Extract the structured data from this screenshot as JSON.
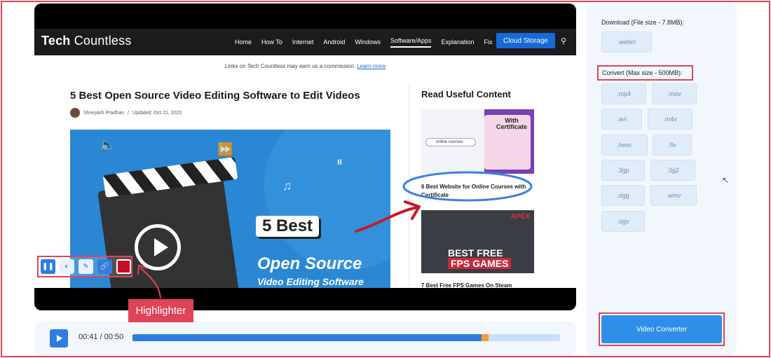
{
  "site": {
    "logo_bold": "Tech",
    "logo_rest": "Countless",
    "nav": [
      "Home",
      "How To",
      "Internet",
      "Android",
      "Windows",
      "Software/Apps",
      "Explanation",
      "Fix"
    ],
    "nav_active": "Software/Apps",
    "cloud_button": "Cloud Storage",
    "search_icon": "search-icon"
  },
  "affiliate": {
    "text": "Links on Tech Countless may earn us a commission.",
    "link": "Learn more"
  },
  "article": {
    "title": "5 Best Open Source Video Editing Software to Edit Videos",
    "author": "Shreyash Pradhan",
    "separator": "/",
    "updated": "Updated: Oct 21, 2022",
    "hero": {
      "badge": "5 Best",
      "line1": "Open Source",
      "line2": "Video Editing Software"
    }
  },
  "sidebar": {
    "title": "Read Useful Content",
    "thumb1": {
      "search_text": "online courses",
      "cert": "With Certificate"
    },
    "card1": "6 Best Website for Online Courses with Certificate",
    "thumb2": {
      "logo": "APEX",
      "line1": "BEST FREE",
      "line2": "FPS GAMES"
    },
    "card2": "7 Best Free FPS Games On Steam"
  },
  "toolbar": {
    "label": "Highlighter",
    "tools": [
      "pause-icon",
      "eraser-icon",
      "pen-icon",
      "link-icon",
      "color-swatch"
    ],
    "swatch_color": "#c80e24"
  },
  "player": {
    "time": "00:41 / 00:50",
    "progress": 0.82,
    "accent": "#2f7de1"
  },
  "panel": {
    "download_label": "Download (File size - 7.8MB):",
    "download_formats": [
      ".webm"
    ],
    "convert_label": "Convert (Max size - 500MB):",
    "convert_formats": [
      ".mp4",
      ".mov",
      ".avi",
      ".m4v",
      ".hevc",
      ".flv",
      ".3gp",
      ".3g2",
      ".ogg",
      ".wmv",
      ".ogv"
    ],
    "converter_button": "Video Converter"
  },
  "colors": {
    "annotation_red": "#e0445a",
    "primary_blue": "#2f7de1"
  }
}
